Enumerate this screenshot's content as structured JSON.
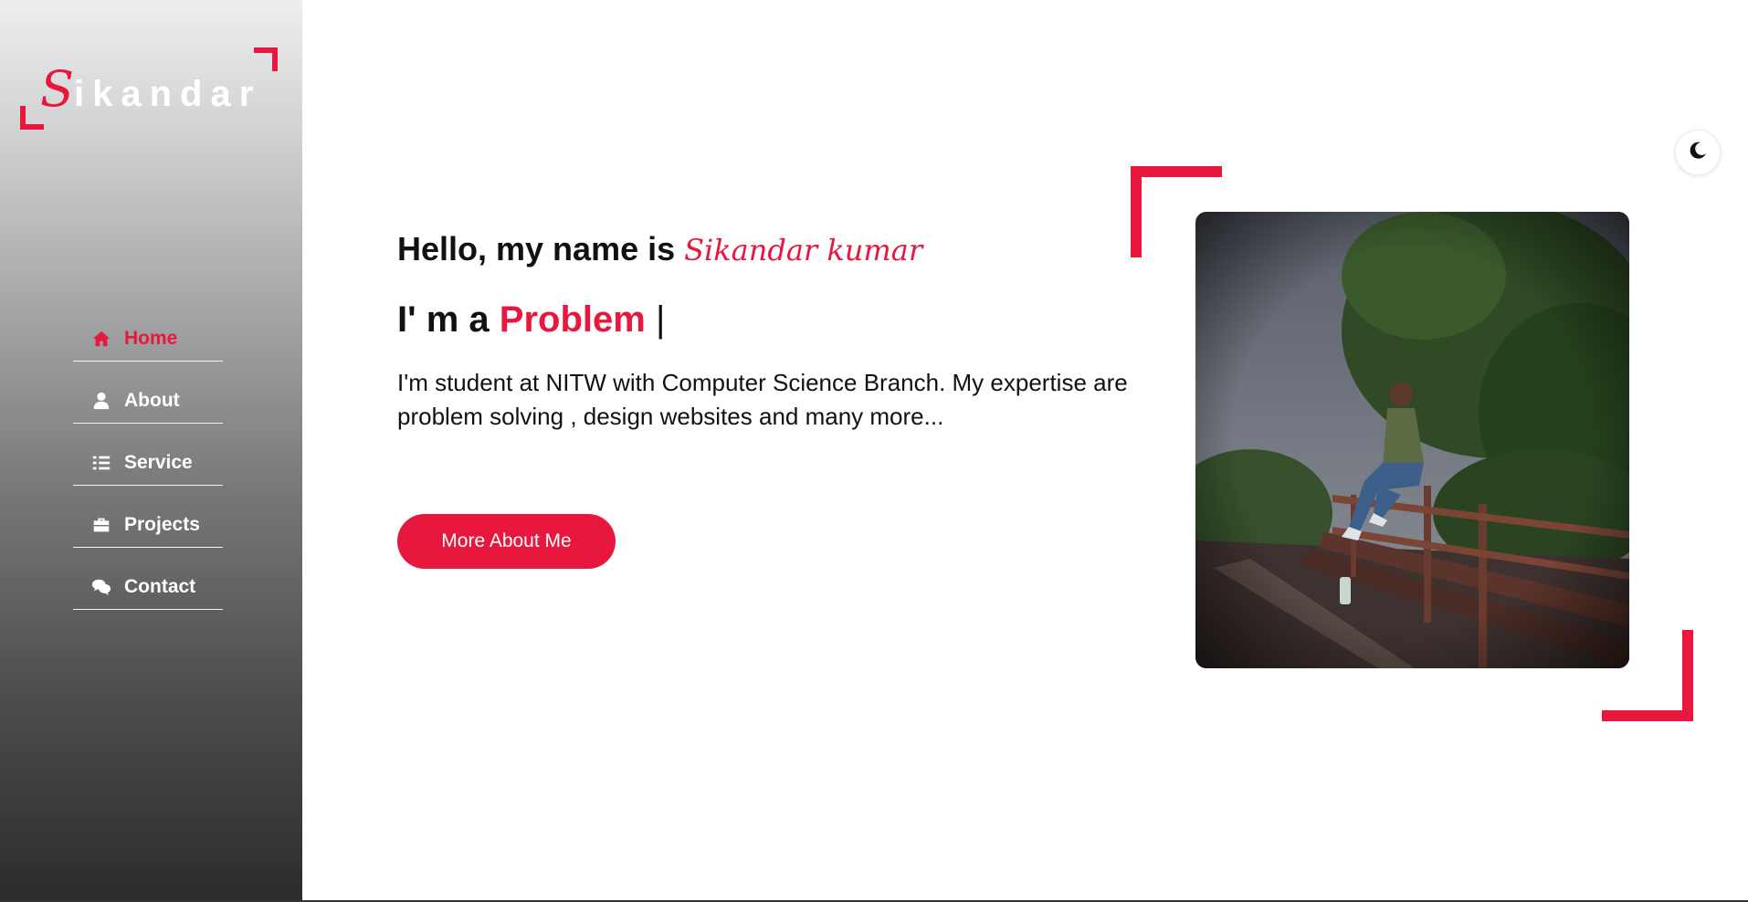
{
  "logo": {
    "initial": "S",
    "rest": "ikandar"
  },
  "nav": {
    "items": [
      {
        "label": "Home",
        "icon": "home-icon",
        "active": true
      },
      {
        "label": "About",
        "icon": "user-icon",
        "active": false
      },
      {
        "label": "Service",
        "icon": "list-icon",
        "active": false
      },
      {
        "label": "Projects",
        "icon": "briefcase-icon",
        "active": false
      },
      {
        "label": "Contact",
        "icon": "comments-icon",
        "active": false
      }
    ]
  },
  "hero": {
    "greeting": "Hello, my name is ",
    "name": "Sikandar kumar",
    "role_prefix": "I' m a ",
    "role_typed": "Problem",
    "cursor": "|",
    "description": "I'm student at NITW with Computer Science Branch. My expertise are problem solving , design websites and many more...",
    "button_label": "More About Me"
  },
  "theme_toggle": {
    "icon": "moon-icon"
  },
  "colors": {
    "accent": "#e8173e",
    "text": "#111111",
    "sidebar_top": "#eceeef",
    "sidebar_bottom": "#2c2c2c"
  }
}
